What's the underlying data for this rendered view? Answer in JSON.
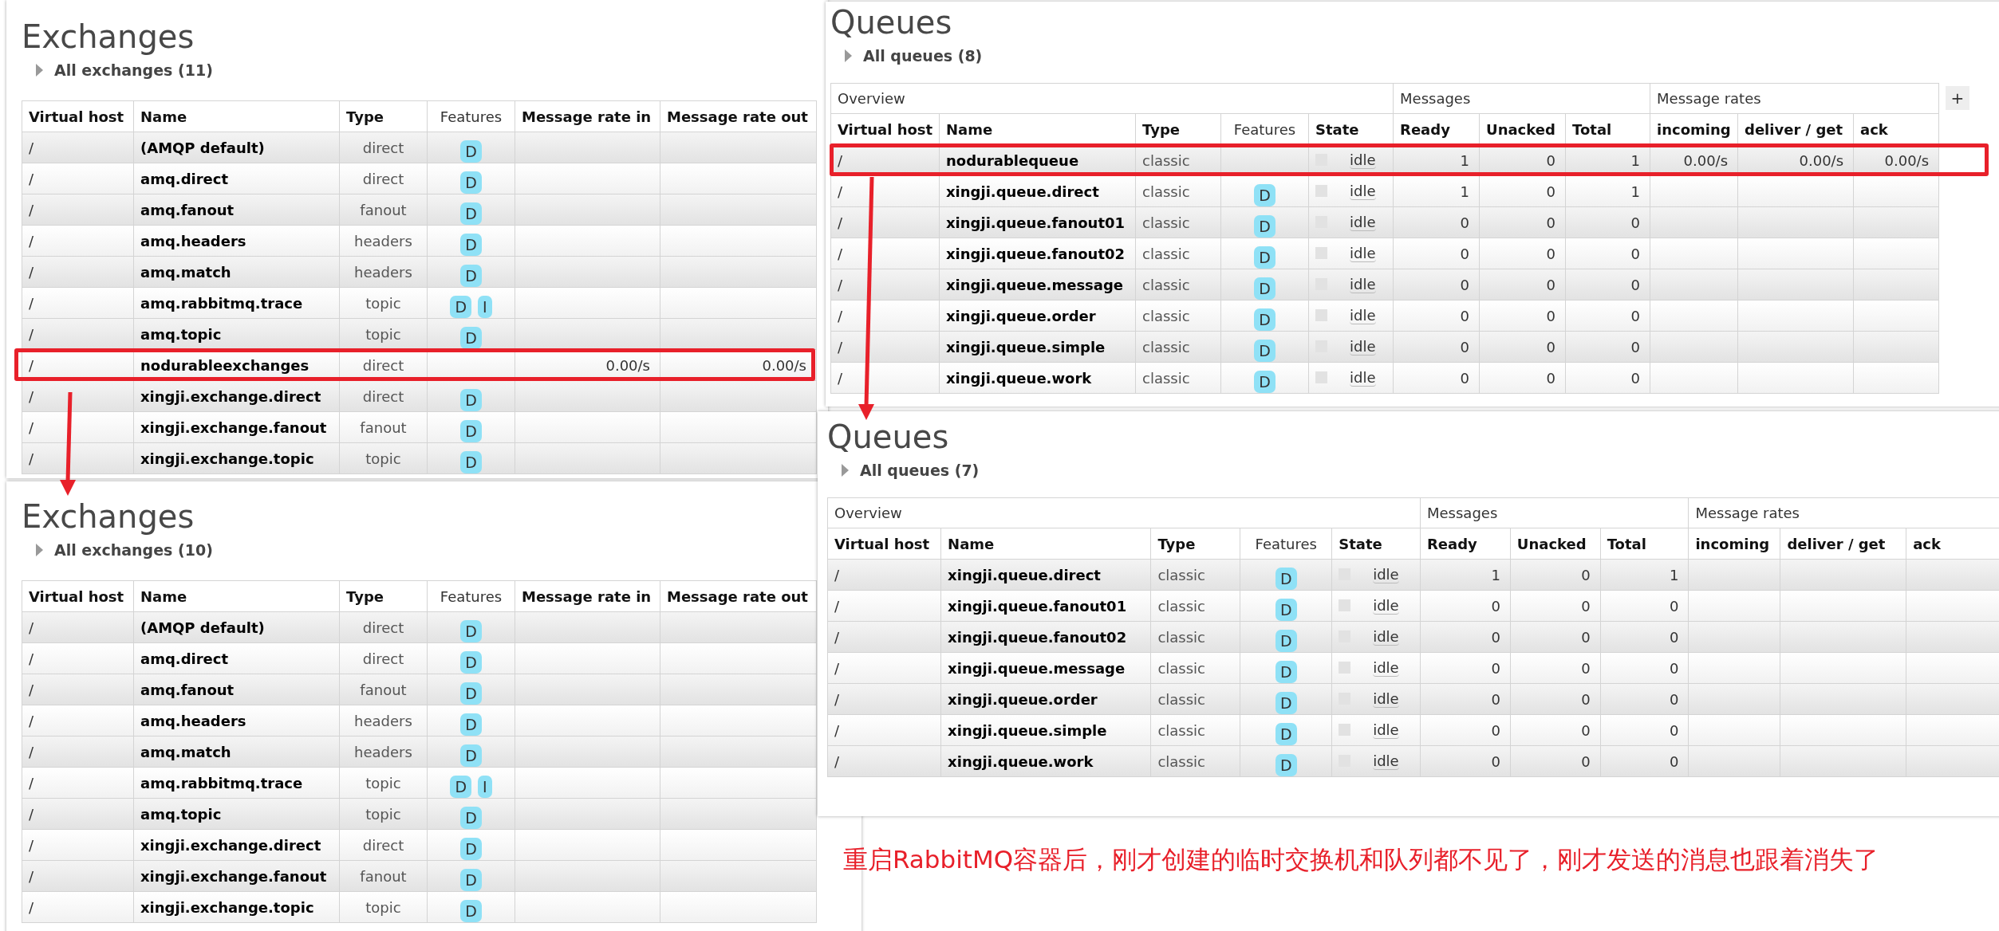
{
  "panels": [
    {
      "kind": "exchanges",
      "title": "Exchanges",
      "summary": "All exchanges (11)",
      "columns": [
        "Virtual host",
        "Name",
        "Type",
        "Features",
        "Message rate in",
        "Message rate out"
      ],
      "rows": [
        {
          "virtual_host": "/",
          "name": "(AMQP default)",
          "type": "direct",
          "features": [
            "D"
          ],
          "highlighted": false
        },
        {
          "virtual_host": "/",
          "name": "amq.direct",
          "type": "direct",
          "features": [
            "D"
          ],
          "highlighted": false
        },
        {
          "virtual_host": "/",
          "name": "amq.fanout",
          "type": "fanout",
          "features": [
            "D"
          ],
          "highlighted": false
        },
        {
          "virtual_host": "/",
          "name": "amq.headers",
          "type": "headers",
          "features": [
            "D"
          ],
          "highlighted": false
        },
        {
          "virtual_host": "/",
          "name": "amq.match",
          "type": "headers",
          "features": [
            "D"
          ],
          "highlighted": false
        },
        {
          "virtual_host": "/",
          "name": "amq.rabbitmq.trace",
          "type": "topic",
          "features": [
            "D",
            "I"
          ],
          "highlighted": false
        },
        {
          "virtual_host": "/",
          "name": "amq.topic",
          "type": "topic",
          "features": [
            "D"
          ],
          "highlighted": false
        },
        {
          "virtual_host": "/",
          "name": "nodurableexchanges",
          "type": "direct",
          "message_rate_in": "0.00/s",
          "message_rate_out": "0.00/s",
          "highlighted": true
        },
        {
          "virtual_host": "/",
          "name": "xingji.exchange.direct",
          "type": "direct",
          "features": [
            "D"
          ],
          "highlighted": false
        },
        {
          "virtual_host": "/",
          "name": "xingji.exchange.fanout",
          "type": "fanout",
          "features": [
            "D"
          ],
          "highlighted": false
        },
        {
          "virtual_host": "/",
          "name": "xingji.exchange.topic",
          "type": "topic",
          "features": [
            "D"
          ],
          "highlighted": false
        }
      ]
    },
    {
      "kind": "exchanges",
      "title": "Exchanges",
      "summary": "All exchanges (10)",
      "columns": [
        "Virtual host",
        "Name",
        "Type",
        "Features",
        "Message rate in",
        "Message rate out"
      ],
      "rows": [
        {
          "virtual_host": "/",
          "name": "(AMQP default)",
          "type": "direct",
          "features": [
            "D"
          ],
          "highlighted": false
        },
        {
          "virtual_host": "/",
          "name": "amq.direct",
          "type": "direct",
          "features": [
            "D"
          ],
          "highlighted": false
        },
        {
          "virtual_host": "/",
          "name": "amq.fanout",
          "type": "fanout",
          "features": [
            "D"
          ],
          "highlighted": false
        },
        {
          "virtual_host": "/",
          "name": "amq.headers",
          "type": "headers",
          "features": [
            "D"
          ],
          "highlighted": false
        },
        {
          "virtual_host": "/",
          "name": "amq.match",
          "type": "headers",
          "features": [
            "D"
          ],
          "highlighted": false
        },
        {
          "virtual_host": "/",
          "name": "amq.rabbitmq.trace",
          "type": "topic",
          "features": [
            "D",
            "I"
          ],
          "highlighted": false
        },
        {
          "virtual_host": "/",
          "name": "amq.topic",
          "type": "topic",
          "features": [
            "D"
          ],
          "highlighted": false
        },
        {
          "virtual_host": "/",
          "name": "xingji.exchange.direct",
          "type": "direct",
          "features": [
            "D"
          ],
          "highlighted": false
        },
        {
          "virtual_host": "/",
          "name": "xingji.exchange.fanout",
          "type": "fanout",
          "features": [
            "D"
          ],
          "highlighted": false
        },
        {
          "virtual_host": "/",
          "name": "xingji.exchange.topic",
          "type": "topic",
          "features": [
            "D"
          ],
          "highlighted": false
        }
      ]
    },
    {
      "kind": "queues",
      "title": "Queues",
      "summary": "All queues (8)",
      "column_toggle": "+",
      "column_groups": [
        {
          "label": "Overview",
          "columns": [
            "Virtual host",
            "Name",
            "Type",
            "Features",
            "State"
          ]
        },
        {
          "label": "Messages",
          "columns": [
            "Ready",
            "Unacked",
            "Total"
          ]
        },
        {
          "label": "Message rates",
          "columns": [
            "incoming",
            "deliver / get",
            "ack"
          ]
        }
      ],
      "rows": [
        {
          "virtual_host": "/",
          "name": "nodurablequeue",
          "type": "classic",
          "state": "idle",
          "ready": "1",
          "unacked": "0",
          "total": "1",
          "incoming": "0.00/s",
          "deliver_get": "0.00/s",
          "ack": "0.00/s",
          "highlighted": true
        },
        {
          "virtual_host": "/",
          "name": "xingji.queue.direct",
          "type": "classic",
          "features": [
            "D"
          ],
          "state": "idle",
          "ready": "1",
          "unacked": "0",
          "total": "1",
          "highlighted": false
        },
        {
          "virtual_host": "/",
          "name": "xingji.queue.fanout01",
          "type": "classic",
          "features": [
            "D"
          ],
          "state": "idle",
          "ready": "0",
          "unacked": "0",
          "total": "0",
          "highlighted": false
        },
        {
          "virtual_host": "/",
          "name": "xingji.queue.fanout02",
          "type": "classic",
          "features": [
            "D"
          ],
          "state": "idle",
          "ready": "0",
          "unacked": "0",
          "total": "0",
          "highlighted": false
        },
        {
          "virtual_host": "/",
          "name": "xingji.queue.message",
          "type": "classic",
          "features": [
            "D"
          ],
          "state": "idle",
          "ready": "0",
          "unacked": "0",
          "total": "0",
          "highlighted": false
        },
        {
          "virtual_host": "/",
          "name": "xingji.queue.order",
          "type": "classic",
          "features": [
            "D"
          ],
          "state": "idle",
          "ready": "0",
          "unacked": "0",
          "total": "0",
          "highlighted": false
        },
        {
          "virtual_host": "/",
          "name": "xingji.queue.simple",
          "type": "classic",
          "features": [
            "D"
          ],
          "state": "idle",
          "ready": "0",
          "unacked": "0",
          "total": "0",
          "highlighted": false
        },
        {
          "virtual_host": "/",
          "name": "xingji.queue.work",
          "type": "classic",
          "features": [
            "D"
          ],
          "state": "idle",
          "ready": "0",
          "unacked": "0",
          "total": "0",
          "highlighted": false
        }
      ]
    },
    {
      "kind": "queues",
      "title": "Queues",
      "summary": "All queues (7)",
      "column_groups": [
        {
          "label": "Overview",
          "columns": [
            "Virtual host",
            "Name",
            "Type",
            "Features",
            "State"
          ]
        },
        {
          "label": "Messages",
          "columns": [
            "Ready",
            "Unacked",
            "Total"
          ]
        },
        {
          "label": "Message rates",
          "columns": [
            "incoming",
            "deliver / get",
            "ack"
          ]
        }
      ],
      "rows": [
        {
          "virtual_host": "/",
          "name": "xingji.queue.direct",
          "type": "classic",
          "features": [
            "D"
          ],
          "state": "idle",
          "ready": "1",
          "unacked": "0",
          "total": "1",
          "highlighted": false
        },
        {
          "virtual_host": "/",
          "name": "xingji.queue.fanout01",
          "type": "classic",
          "features": [
            "D"
          ],
          "state": "idle",
          "ready": "0",
          "unacked": "0",
          "total": "0",
          "highlighted": false
        },
        {
          "virtual_host": "/",
          "name": "xingji.queue.fanout02",
          "type": "classic",
          "features": [
            "D"
          ],
          "state": "idle",
          "ready": "0",
          "unacked": "0",
          "total": "0",
          "highlighted": false
        },
        {
          "virtual_host": "/",
          "name": "xingji.queue.message",
          "type": "classic",
          "features": [
            "D"
          ],
          "state": "idle",
          "ready": "0",
          "unacked": "0",
          "total": "0",
          "highlighted": false
        },
        {
          "virtual_host": "/",
          "name": "xingji.queue.order",
          "type": "classic",
          "features": [
            "D"
          ],
          "state": "idle",
          "ready": "0",
          "unacked": "0",
          "total": "0",
          "highlighted": false
        },
        {
          "virtual_host": "/",
          "name": "xingji.queue.simple",
          "type": "classic",
          "features": [
            "D"
          ],
          "state": "idle",
          "ready": "0",
          "unacked": "0",
          "total": "0",
          "highlighted": false
        },
        {
          "virtual_host": "/",
          "name": "xingji.queue.work",
          "type": "classic",
          "features": [
            "D"
          ],
          "state": "idle",
          "ready": "0",
          "unacked": "0",
          "total": "0",
          "highlighted": false
        }
      ]
    }
  ],
  "caption": "重启RabbitMQ容器后，刚才创建的临时交换机和队列都不见了，刚才发送的消息也跟着消失了"
}
